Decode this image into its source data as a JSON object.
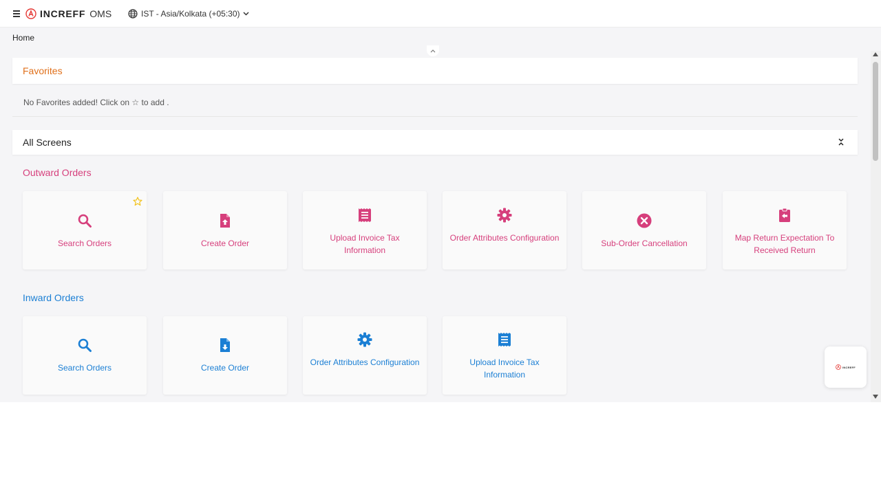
{
  "header": {
    "logo_text": "INCREFF",
    "logo_suffix": "OMS",
    "timezone": "IST - Asia/Kolkata (+05:30)"
  },
  "breadcrumb": "Home",
  "favorites": {
    "title": "Favorites",
    "empty_message": "No Favorites added! Click on ☆ to add ."
  },
  "all_screens": {
    "title": "All Screens"
  },
  "outward": {
    "title": "Outward Orders",
    "cards": [
      {
        "label": "Search Orders",
        "icon": "search-icon",
        "favorite": true
      },
      {
        "label": "Create Order",
        "icon": "file-upload-icon"
      },
      {
        "label": "Upload Invoice Tax Information",
        "icon": "receipt-icon"
      },
      {
        "label": "Order Attributes Configuration",
        "icon": "gear-icon"
      },
      {
        "label": "Sub-Order Cancellation",
        "icon": "cancel-circle-icon"
      },
      {
        "label": "Map Return Expectation To Received Return",
        "icon": "clipboard-return-icon"
      }
    ]
  },
  "inward": {
    "title": "Inward Orders",
    "cards": [
      {
        "label": "Search Orders",
        "icon": "search-icon"
      },
      {
        "label": "Create Order",
        "icon": "file-download-icon"
      },
      {
        "label": "Order Attributes Configuration",
        "icon": "gear-icon"
      },
      {
        "label": "Upload Invoice Tax Information",
        "icon": "receipt-icon"
      }
    ]
  },
  "widget": {
    "text": "INCREFF"
  },
  "colors": {
    "outward_accent": "#d63f7c",
    "inward_accent": "#1b7fd4",
    "favorites_accent": "#e0701b",
    "star": "#f2c21b"
  }
}
